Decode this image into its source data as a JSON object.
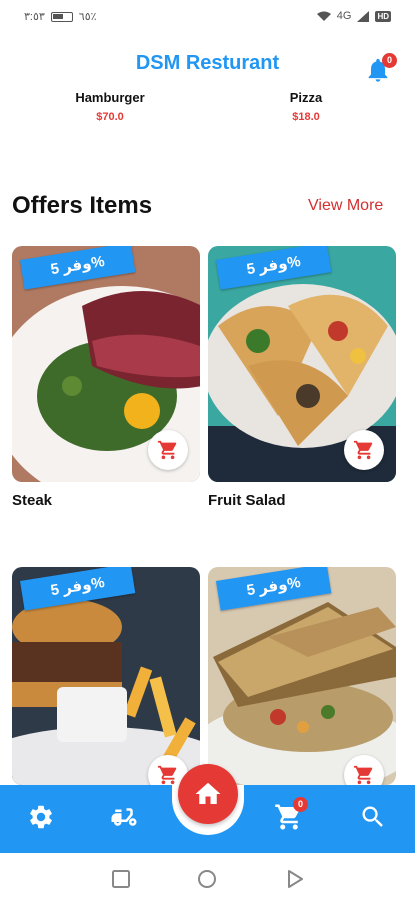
{
  "status_bar": {
    "time": "٣:٥٣",
    "battery": "٦٥٪",
    "network": "4G",
    "chip": "HD"
  },
  "header": {
    "title": "DSM Resturant",
    "notification_count": "0"
  },
  "top_items": [
    {
      "name": "Hamburger",
      "price": "$70.0"
    },
    {
      "name": "Pizza",
      "price": "$18.0"
    }
  ],
  "section": {
    "title": "Offers Items",
    "view_more": "View More"
  },
  "offers": [
    {
      "tag": "وفر 5%",
      "name": "Steak"
    },
    {
      "tag": "وفر 5%",
      "name": "Fruit Salad"
    },
    {
      "tag": "وفر 5%",
      "name": ""
    },
    {
      "tag": "وفر 5%",
      "name": ""
    }
  ],
  "bottom_nav": {
    "cart_count": "0",
    "icons": [
      "gear-icon",
      "delivery-scooter-icon",
      "home-icon",
      "cart-icon",
      "search-icon"
    ]
  },
  "colors": {
    "primary": "#2196f3",
    "accent": "#e53935",
    "price": "#e53935",
    "view_more": "#d32f2f"
  }
}
